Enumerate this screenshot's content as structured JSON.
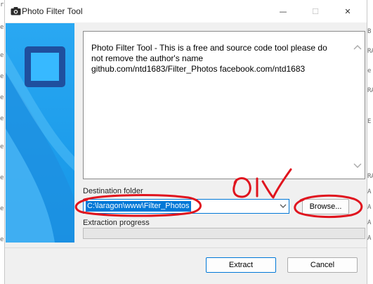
{
  "window": {
    "title": "Photo Filter Tool",
    "minimize_glyph": "—",
    "maximize_glyph": "☐",
    "close_glyph": "✕"
  },
  "info": {
    "lines": [
      "Photo Filter Tool - This is a free and source code tool please do",
      "not remove the author's name",
      "github.com/ntd1683/Filter_Photos facebook.com/ntd1683"
    ]
  },
  "destination": {
    "label": "Destination folder",
    "value": "C:\\laragon\\www\\Filter_Photos"
  },
  "progress": {
    "label": "Extraction progress",
    "value": 0
  },
  "buttons": {
    "browse": "Browse...",
    "extract": "Extract",
    "cancel": "Cancel"
  },
  "annotation": {
    "handwritten_text": "OIV",
    "color": "#e0141e"
  },
  "background_fragments": {
    "left": [
      "rc_",
      "e",
      "e",
      "e",
      "e",
      "e",
      "e",
      "e",
      "e",
      "e"
    ],
    "right": [
      "B",
      "RA",
      "e",
      "RA",
      "E",
      "RA",
      "A",
      "A",
      "A",
      "A"
    ]
  },
  "colors": {
    "accent": "#0078d7",
    "banner_light": "#37b9ff",
    "banner_dark": "#1f4f9e"
  }
}
